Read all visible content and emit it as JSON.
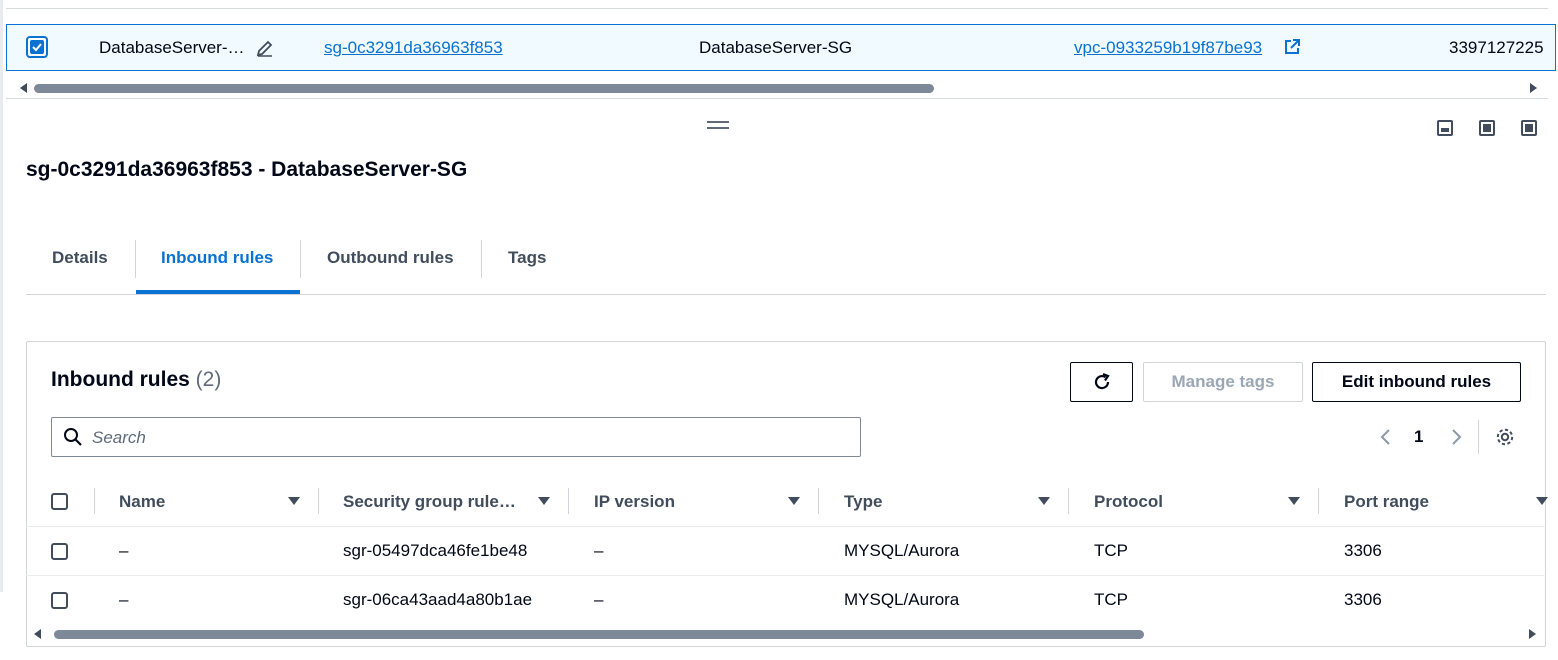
{
  "top_row": {
    "name": "DatabaseServer-…",
    "sg_id": "sg-0c3291da36963f853",
    "sg_name": "DatabaseServer-SG",
    "vpc_id": "vpc-0933259b19f87be93",
    "owner": "3397127225"
  },
  "panel": {
    "title": "sg-0c3291da36963f853 - DatabaseServer-SG",
    "tabs": [
      {
        "label": "Details",
        "active": false
      },
      {
        "label": "Inbound rules",
        "active": true
      },
      {
        "label": "Outbound rules",
        "active": false
      },
      {
        "label": "Tags",
        "active": false
      }
    ]
  },
  "inbound": {
    "title": "Inbound rules",
    "count": "(2)",
    "buttons": {
      "refresh_icon": "refresh-icon",
      "manage_tags": "Manage tags",
      "edit_inbound": "Edit inbound rules"
    },
    "search": {
      "placeholder": "Search",
      "value": ""
    },
    "pagination": {
      "page": "1"
    },
    "columns": [
      "Name",
      "Security group rule…",
      "IP version",
      "Type",
      "Protocol",
      "Port range"
    ],
    "rows": [
      {
        "name": "–",
        "rule_id": "sgr-05497dca46fe1be48",
        "ip_version": "–",
        "type": "MYSQL/Aurora",
        "protocol": "TCP",
        "port_range": "3306"
      },
      {
        "name": "–",
        "rule_id": "sgr-06ca43aad4a80b1ae",
        "ip_version": "–",
        "type": "MYSQL/Aurora",
        "protocol": "TCP",
        "port_range": "3306"
      }
    ]
  },
  "colors": {
    "accent": "#0972d3",
    "text": "#000716",
    "muted": "#414d5c",
    "border": "#d1d5db"
  }
}
